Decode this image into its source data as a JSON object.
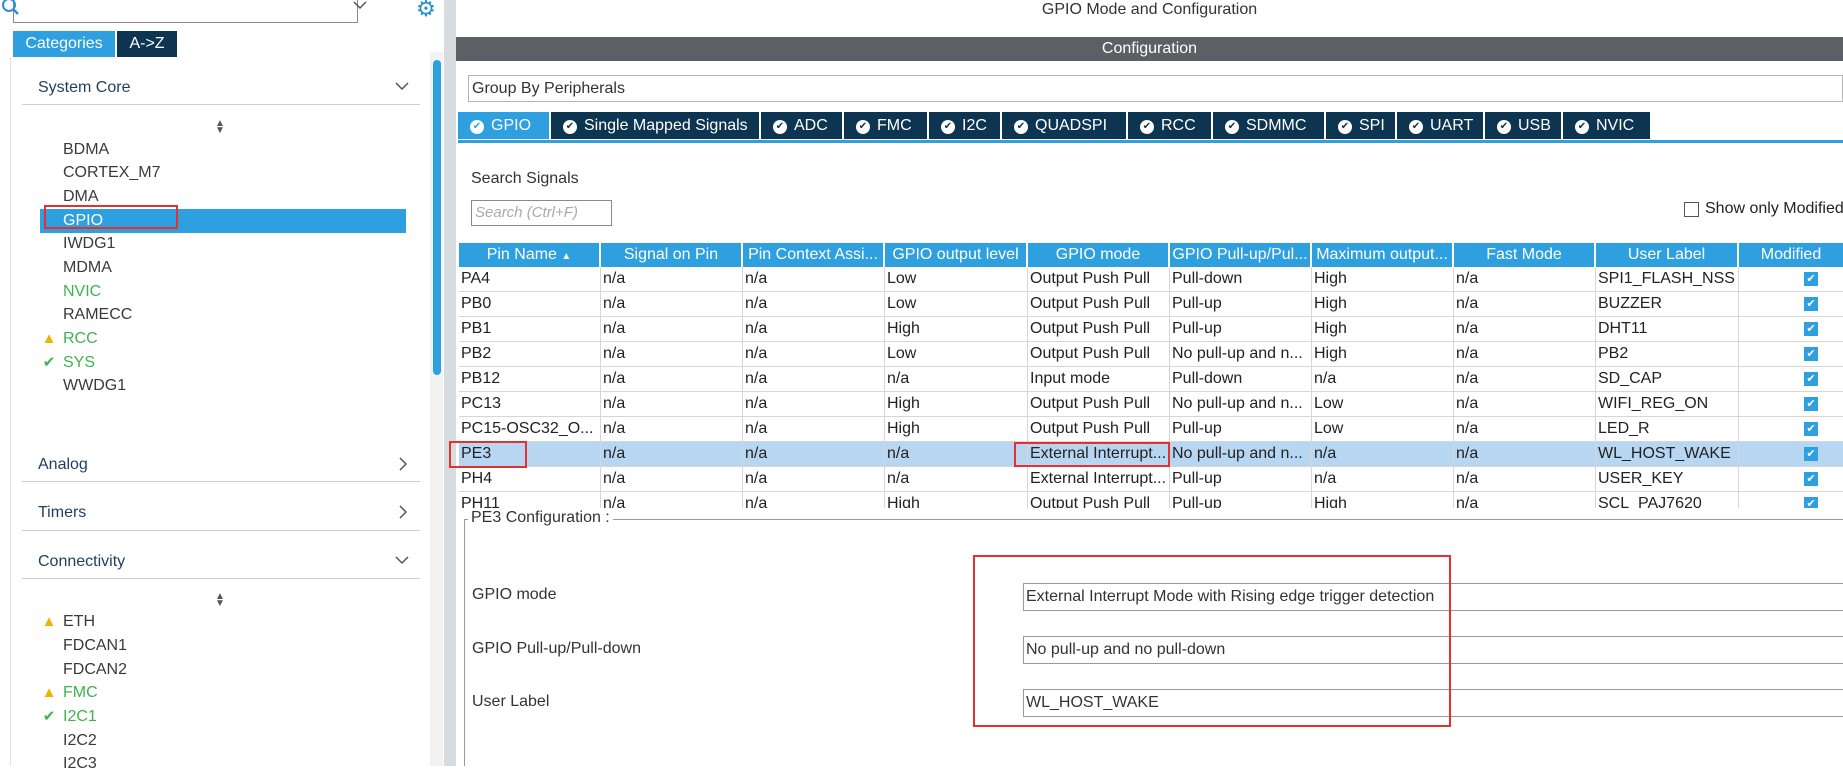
{
  "left": {
    "tabs": {
      "categories": "Categories",
      "az": "A->Z"
    },
    "sections": [
      {
        "title": "System Core",
        "items": [
          {
            "label": "BDMA",
            "status": "none"
          },
          {
            "label": "CORTEX_M7",
            "status": "none"
          },
          {
            "label": "DMA",
            "status": "none"
          },
          {
            "label": "GPIO",
            "status": "selected"
          },
          {
            "label": "IWDG1",
            "status": "none"
          },
          {
            "label": "MDMA",
            "status": "none"
          },
          {
            "label": "NVIC",
            "status": "green"
          },
          {
            "label": "RAMECC",
            "status": "none"
          },
          {
            "label": "RCC",
            "status": "warning"
          },
          {
            "label": "SYS",
            "status": "ok"
          },
          {
            "label": "WWDG1",
            "status": "none"
          }
        ]
      },
      {
        "title": "Analog"
      },
      {
        "title": "Timers"
      },
      {
        "title": "Connectivity",
        "items": [
          {
            "label": "ETH",
            "status": "warning"
          },
          {
            "label": "FDCAN1",
            "status": "none"
          },
          {
            "label": "FDCAN2",
            "status": "none"
          },
          {
            "label": "FMC",
            "status": "warning"
          },
          {
            "label": "I2C1",
            "status": "ok"
          },
          {
            "label": "I2C2",
            "status": "none"
          },
          {
            "label": "I2C3",
            "status": "none"
          }
        ]
      }
    ]
  },
  "main": {
    "title": "GPIO Mode and Configuration",
    "config_bar": "Configuration",
    "group_by": "Group By Peripherals",
    "tabs": [
      "GPIO",
      "Single Mapped Signals",
      "ADC",
      "FMC",
      "I2C",
      "QUADSPI",
      "RCC",
      "SDMMC",
      "SPI",
      "UART",
      "USB",
      "NVIC"
    ],
    "active_tab": "GPIO",
    "search_label": "Search Signals",
    "search_placeholder": "Search (Ctrl+F)",
    "show_modified_label": "Show only Modified",
    "table": {
      "columns": [
        "Pin Name",
        "Signal on Pin",
        "Pin Context Assi...",
        "GPIO output level",
        "GPIO mode",
        "GPIO Pull-up/Pul...",
        "Maximum output...",
        "Fast Mode",
        "User Label",
        "Modified"
      ],
      "rows": [
        [
          "PA4",
          "n/a",
          "n/a",
          "Low",
          "Output Push Pull",
          "Pull-down",
          "High",
          "n/a",
          "SPI1_FLASH_NSS"
        ],
        [
          "PB0",
          "n/a",
          "n/a",
          "Low",
          "Output Push Pull",
          "Pull-up",
          "High",
          "n/a",
          "BUZZER"
        ],
        [
          "PB1",
          "n/a",
          "n/a",
          "High",
          "Output Push Pull",
          "Pull-up",
          "High",
          "n/a",
          "DHT11"
        ],
        [
          "PB2",
          "n/a",
          "n/a",
          "Low",
          "Output Push Pull",
          "No pull-up and n...",
          "High",
          "n/a",
          "PB2"
        ],
        [
          "PB12",
          "n/a",
          "n/a",
          "n/a",
          "Input mode",
          "Pull-down",
          "n/a",
          "n/a",
          "SD_CAP"
        ],
        [
          "PC13",
          "n/a",
          "n/a",
          "High",
          "Output Push Pull",
          "No pull-up and n...",
          "Low",
          "n/a",
          "WIFI_REG_ON"
        ],
        [
          "PC15-OSC32_O...",
          "n/a",
          "n/a",
          "High",
          "Output Push Pull",
          "Pull-up",
          "Low",
          "n/a",
          "LED_R"
        ],
        [
          "PE3",
          "n/a",
          "n/a",
          "n/a",
          "External Interrupt...",
          "No pull-up and n...",
          "n/a",
          "n/a",
          "WL_HOST_WAKE"
        ],
        [
          "PH4",
          "n/a",
          "n/a",
          "n/a",
          "External Interrupt...",
          "Pull-up",
          "n/a",
          "n/a",
          "USER_KEY"
        ],
        [
          "PH11",
          "n/a",
          "n/a",
          "High",
          "Output Push Pull",
          "Pull-up",
          "High",
          "n/a",
          "SCL_PAJ7620"
        ]
      ],
      "selected_row": "PE3"
    },
    "pin_config": {
      "title": "PE3 Configuration :",
      "fields": [
        {
          "label": "GPIO mode",
          "value": "External Interrupt Mode with Rising edge trigger detection"
        },
        {
          "label": "GPIO Pull-up/Pull-down",
          "value": "No pull-up and no pull-down"
        },
        {
          "label": "User Label",
          "value": "WL_HOST_WAKE"
        }
      ]
    }
  },
  "colors": {
    "accent": "#2fa0df",
    "dark_tab": "#0d3552",
    "highlight": "#e53030",
    "ok": "#3fb34f",
    "warning": "#f0b400"
  }
}
